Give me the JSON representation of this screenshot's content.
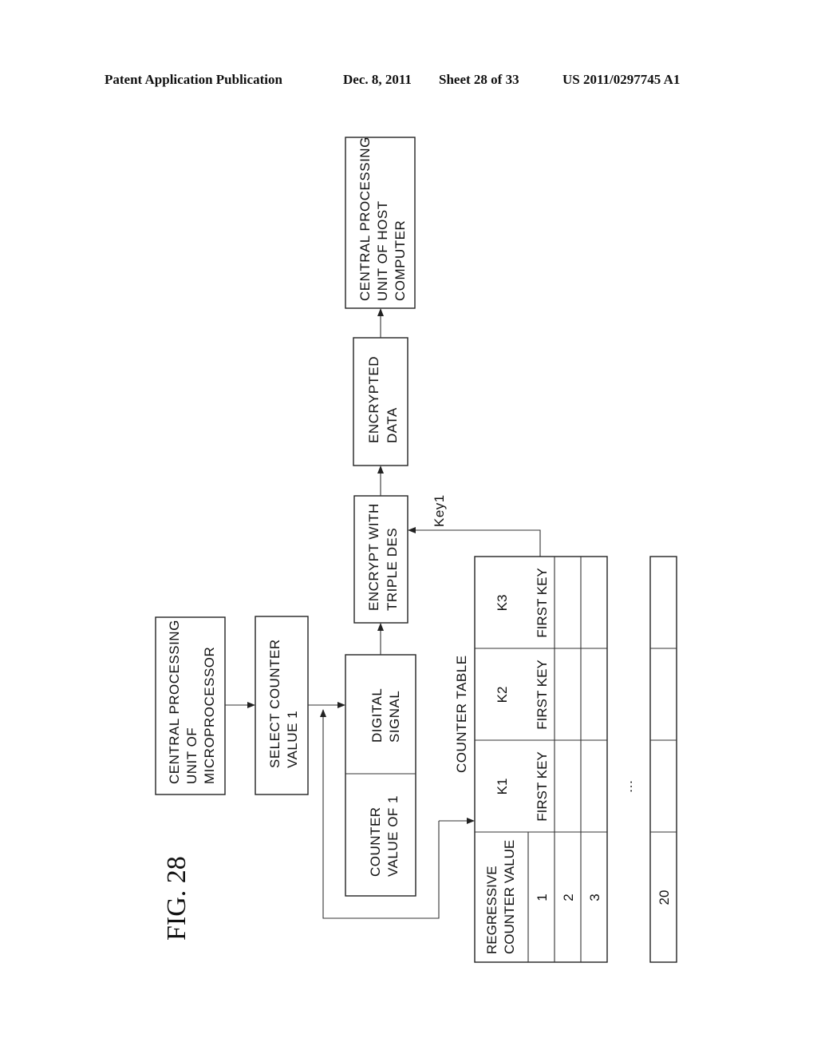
{
  "header": {
    "publication": "Patent Application Publication",
    "date": "Dec. 8, 2011",
    "sheet": "Sheet 28 of 33",
    "number": "US 2011/0297745 A1"
  },
  "figure_label": "FIG. 28",
  "nodes": {
    "cpu_microprocessor": [
      "CENTRAL PROCESSING",
      "UNIT OF",
      "MICROPROCESSOR"
    ],
    "select_counter": [
      "SELECT COUNTER",
      "VALUE 1"
    ],
    "counter_value": [
      "COUNTER",
      "VALUE OF 1"
    ],
    "digital_signal": [
      "DIGITAL",
      "SIGNAL"
    ],
    "encrypt": [
      "ENCRYPT WITH",
      "TRIPLE DES"
    ],
    "encrypted_data": [
      "ENCRYPTED",
      "DATA"
    ],
    "cpu_host": [
      "CENTRAL PROCESSING",
      "UNIT OF HOST",
      "COMPUTER"
    ]
  },
  "key_label": "Key1",
  "counter_table": {
    "title": "COUNTER TABLE",
    "header_first": [
      "REGRESSIVE",
      "COUNTER VALUE"
    ],
    "columns": [
      "K1",
      "K2",
      "K3"
    ],
    "rows": [
      {
        "value": "1",
        "cells": [
          "FIRST KEY",
          "FIRST KEY",
          "FIRST KEY"
        ]
      },
      {
        "value": "2",
        "cells": [
          "",
          "",
          ""
        ]
      },
      {
        "value": "3",
        "cells": [
          "",
          "",
          ""
        ]
      }
    ],
    "ellipsis": "…",
    "last_row": {
      "value": "20",
      "cells": [
        "",
        "",
        ""
      ]
    }
  }
}
